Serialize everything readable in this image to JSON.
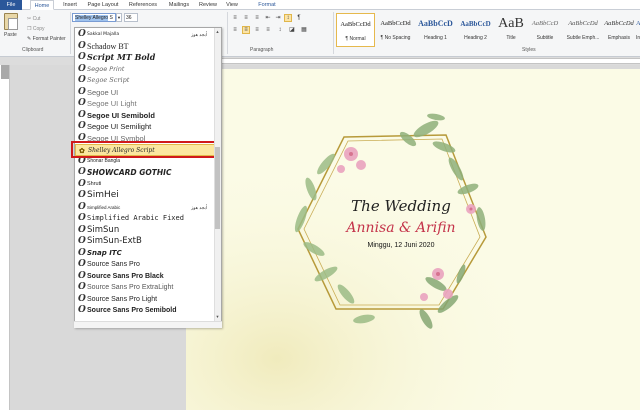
{
  "tabs": {
    "file": "File",
    "home": "Home",
    "insert": "Insert",
    "page_layout": "Page Layout",
    "references": "References",
    "mailings": "Mailings",
    "review": "Review",
    "view": "View",
    "format": "Format"
  },
  "clipboard": {
    "paste": "Paste",
    "cut": "Cut",
    "copy": "Copy",
    "format_painter": "Format Painter",
    "group": "Clipboard"
  },
  "font": {
    "name_selected": "Shelley Allegro",
    "name_rest": " S",
    "size": "36"
  },
  "paragraph": {
    "group": "Paragraph"
  },
  "styles": {
    "group": "Styles",
    "items": [
      {
        "preview": "AaBbCcDd",
        "name": "¶ Normal"
      },
      {
        "preview": "AaBbCcDd",
        "name": "¶ No Spacing"
      },
      {
        "preview": "AaBbCcD",
        "name": "Heading 1"
      },
      {
        "preview": "AaBbCcD",
        "name": "Heading 2"
      },
      {
        "preview": "AaB",
        "name": "Title"
      },
      {
        "preview": "AaBbCcD",
        "name": "Subtitle"
      },
      {
        "preview": "AaBbCcDd",
        "name": "Subtle Emph..."
      },
      {
        "preview": "AaBbCcDd",
        "name": "Emphasis"
      },
      {
        "preview": "AaBbC",
        "name": "Intens"
      }
    ]
  },
  "font_list": [
    {
      "name": "Sakkal Majalla",
      "sample": "أبجد هوز"
    },
    {
      "name": "Schadow BT"
    },
    {
      "name": "Script MT Bold"
    },
    {
      "name": "Segoe Print"
    },
    {
      "name": "Segoe Script"
    },
    {
      "name": "Segoe UI"
    },
    {
      "name": "Segoe UI Light"
    },
    {
      "name": "Segoe UI Semibold"
    },
    {
      "name": "Segoe UI Semilight"
    },
    {
      "name": "Segoe UI Symbol"
    },
    {
      "name": "Shelley Allegro Script"
    },
    {
      "name": "Shonar Bangla"
    },
    {
      "name": "SHOWCARD GOTHIC"
    },
    {
      "name": "Shruti"
    },
    {
      "name": "SimHei"
    },
    {
      "name": "Simplified Arabic",
      "sample": "أبجد هوز"
    },
    {
      "name": "Simplified Arabic Fixed"
    },
    {
      "name": "SimSun"
    },
    {
      "name": "SimSun-ExtB"
    },
    {
      "name": "Snap ITC"
    },
    {
      "name": "Source Sans Pro"
    },
    {
      "name": "Source Sans Pro Black"
    },
    {
      "name": "Source Sans Pro ExtraLight"
    },
    {
      "name": "Source Sans Pro Light"
    },
    {
      "name": "Source Sans Pro Semibold"
    }
  ],
  "font_list_selected": 10,
  "document": {
    "title": "The Wedding",
    "names": "Annisa & Arifin",
    "date": "Minggu, 12 Juni 2020"
  },
  "colors": {
    "accent": "#2b579a",
    "highlight_box": "#d0191b",
    "page": "#fbfbe6",
    "gold": "#b79a3a",
    "names": "#c4334a"
  }
}
